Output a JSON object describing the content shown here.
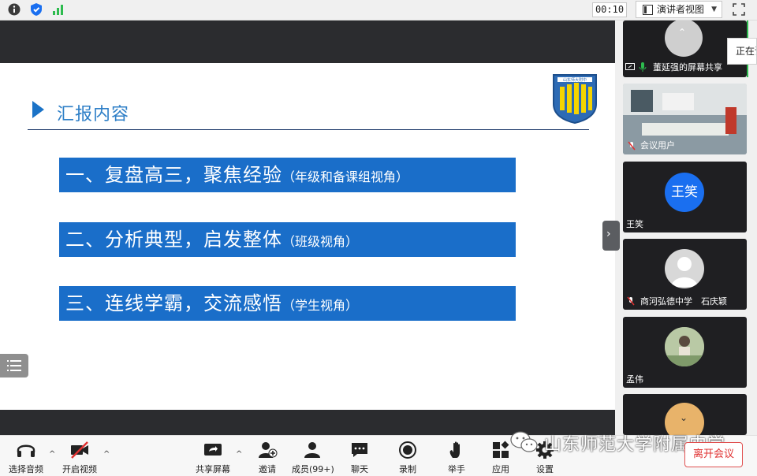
{
  "topbar": {
    "timer": "00:10",
    "view_mode": "演讲者视图"
  },
  "slide": {
    "title": "汇报内容",
    "items": [
      {
        "main": "一、复盘高三，聚焦经验",
        "sub": "（年级和备课组视角）"
      },
      {
        "main": "二、分析典型，启发整体",
        "sub": "（班级视角）"
      },
      {
        "main": "三、连线学霸，交流感悟",
        "sub": "（学生视角）"
      }
    ],
    "logo_text": "山东师大附中"
  },
  "participants": {
    "side_tab": "正在讲",
    "tiles": [
      {
        "label": "董延强的屏幕共享"
      },
      {
        "label": "会议用户"
      },
      {
        "label": "王笑",
        "avatar_text": "王笑"
      },
      {
        "label": "商河弘德中学　石庆颖"
      },
      {
        "label": "孟伟"
      }
    ]
  },
  "toolbar": {
    "audio": "选择音频",
    "video": "开启视频",
    "share": "共享屏幕",
    "invite": "邀请",
    "members": "成员(99+)",
    "chat": "聊天",
    "record": "录制",
    "raise_hand": "举手",
    "apps": "应用",
    "settings": "设置",
    "leave": "离开会议"
  },
  "watermark": "山东师范大学附属中学",
  "colors": {
    "slide_blue": "#1a6ec9",
    "title_blue": "#2e7fc7",
    "leave_red": "#e03030",
    "avatar_blue": "#1a6ff0"
  }
}
